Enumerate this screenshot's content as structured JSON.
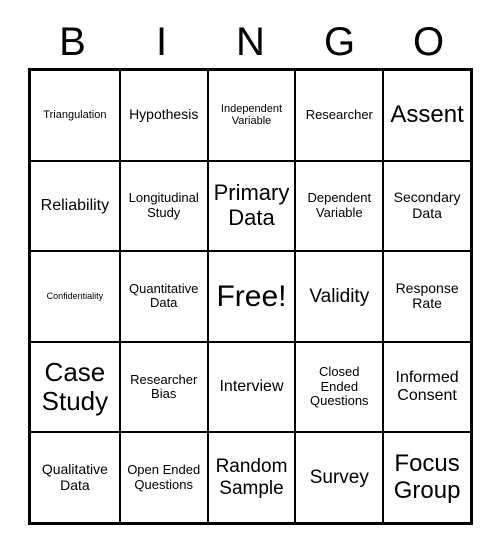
{
  "card": {
    "title": "BINGO",
    "header_letters": [
      "B",
      "I",
      "N",
      "G",
      "O"
    ],
    "free_space_label": "Free!",
    "colors": {
      "background": "#ffffff",
      "text": "#000000",
      "border": "#000000"
    },
    "grid": {
      "rows": 5,
      "columns": 5,
      "cells": [
        [
          {
            "text": "Triangulation",
            "size": "fs-s"
          },
          {
            "text": "Hypothesis",
            "size": "fs-ml"
          },
          {
            "text": "Independent Variable",
            "size": "fs-s"
          },
          {
            "text": "Researcher",
            "size": "fs-m"
          },
          {
            "text": "Assent",
            "size": "fs-h"
          }
        ],
        [
          {
            "text": "Reliability",
            "size": "fs-l"
          },
          {
            "text": "Longitudinal Study",
            "size": "fs-m"
          },
          {
            "text": "Primary Data",
            "size": "fs-xxl"
          },
          {
            "text": "Dependent Variable",
            "size": "fs-m"
          },
          {
            "text": "Secondary Data",
            "size": "fs-ml"
          }
        ],
        [
          {
            "text": "Confidentiality",
            "size": "fs-xs"
          },
          {
            "text": "Quantitative Data",
            "size": "fs-m"
          },
          {
            "text": "Free!",
            "size": "fs-max"
          },
          {
            "text": "Validity",
            "size": "fs-xl"
          },
          {
            "text": "Response Rate",
            "size": "fs-ml"
          }
        ],
        [
          {
            "text": "Case Study",
            "size": "fs-hh"
          },
          {
            "text": "Researcher Bias",
            "size": "fs-m"
          },
          {
            "text": "Interview",
            "size": "fs-l"
          },
          {
            "text": "Closed Ended Questions",
            "size": "fs-m"
          },
          {
            "text": "Informed Consent",
            "size": "fs-l"
          }
        ],
        [
          {
            "text": "Qualitative Data",
            "size": "fs-ml"
          },
          {
            "text": "Open Ended Questions",
            "size": "fs-m"
          },
          {
            "text": "Random Sample",
            "size": "fs-xl"
          },
          {
            "text": "Survey",
            "size": "fs-xl"
          },
          {
            "text": "Focus Group",
            "size": "fs-h"
          }
        ]
      ]
    }
  }
}
